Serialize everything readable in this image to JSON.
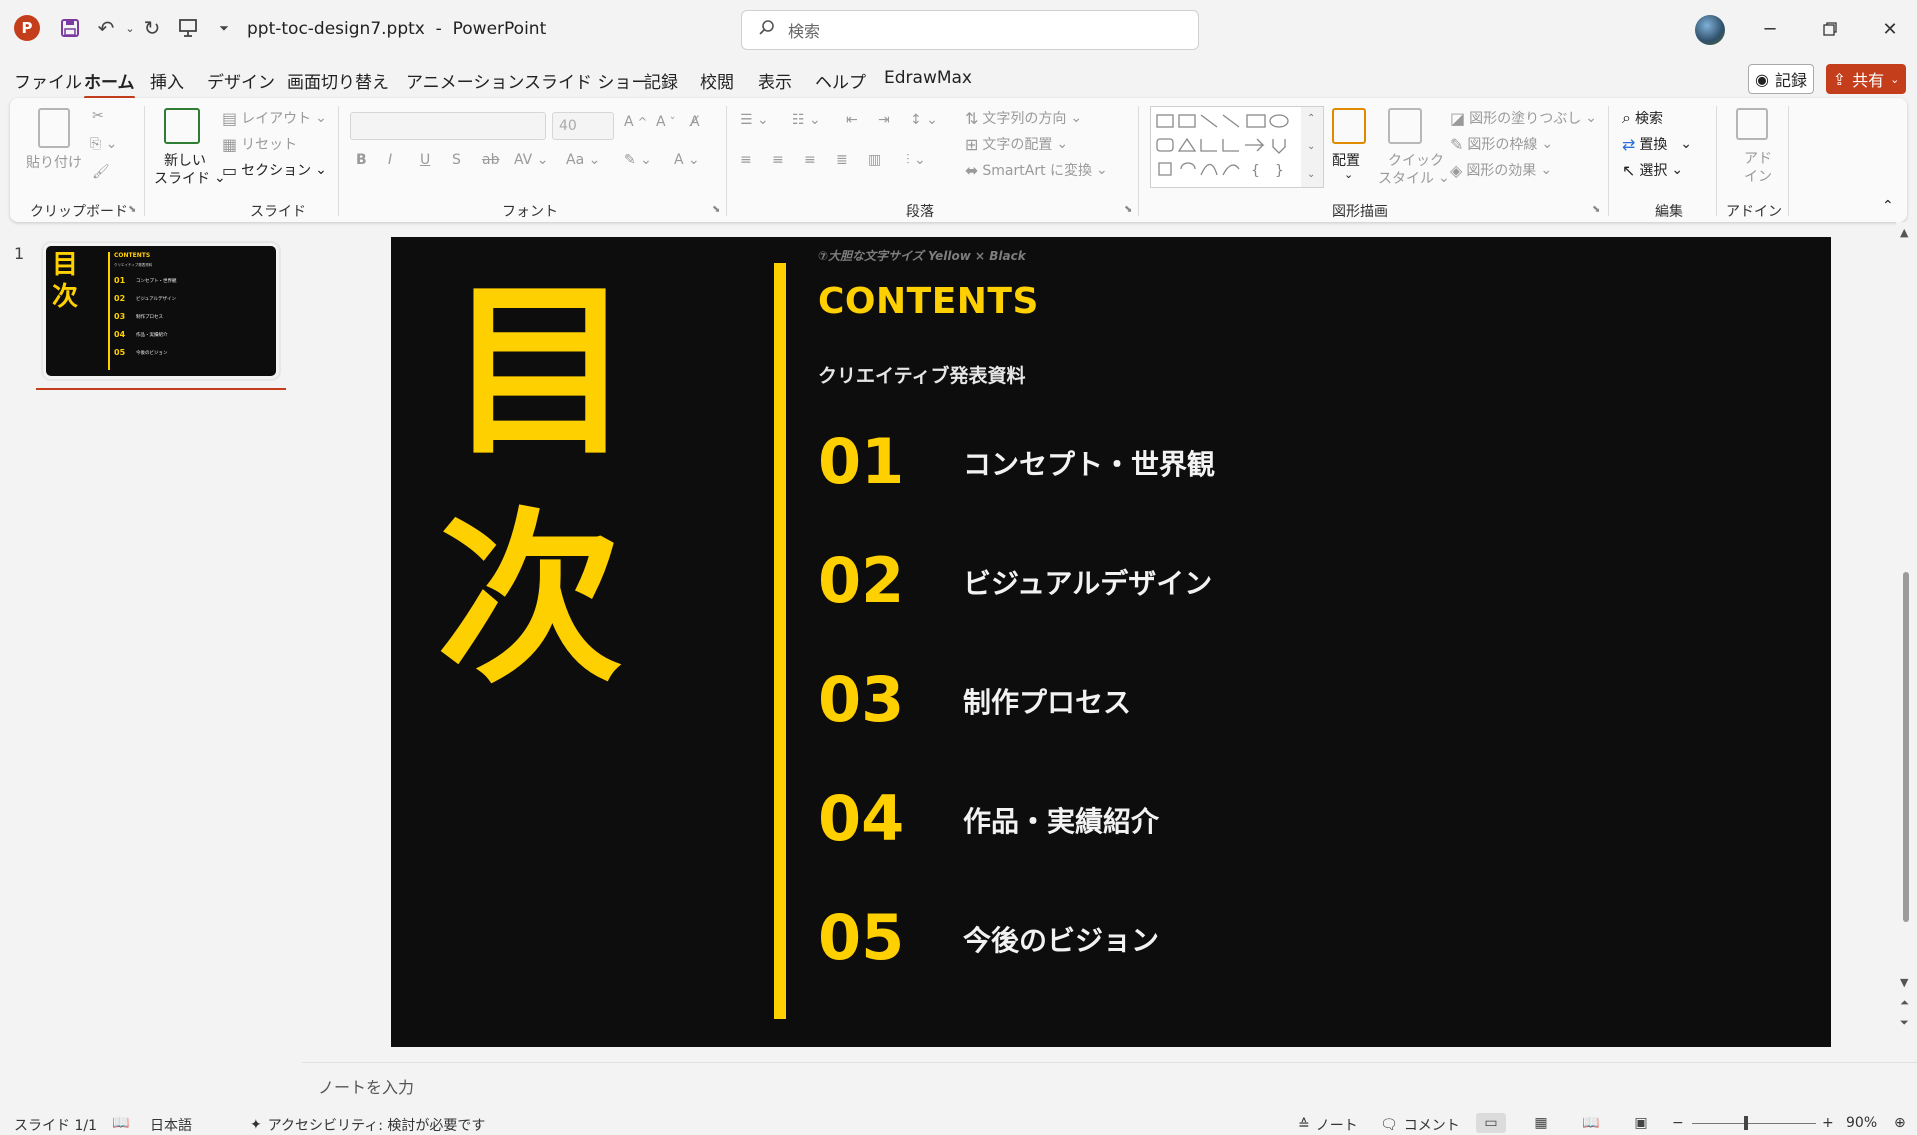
{
  "app": {
    "filename": "ppt-toc-design7.pptx",
    "separator": "-",
    "app_name": "PowerPoint",
    "search_placeholder": "検索"
  },
  "menu_tabs": [
    "ファイル",
    "ホーム",
    "挿入",
    "デザイン",
    "画面切り替え",
    "アニメーション",
    "スライド ショー",
    "記録",
    "校閲",
    "表示",
    "ヘルプ",
    "EdrawMax"
  ],
  "active_tab": "ホーム",
  "top_right": {
    "record": "記録",
    "share": "共有"
  },
  "ribbon": {
    "clipboard": {
      "label": "クリップボード",
      "paste": "貼り付け"
    },
    "slides": {
      "label": "スライド",
      "new_slide_1": "新しい",
      "new_slide_2": "スライド",
      "layout": "レイアウト",
      "reset": "リセット",
      "section": "セクション"
    },
    "font": {
      "label": "フォント",
      "size": "40"
    },
    "paragraph": {
      "label": "段落",
      "text_direction": "文字列の方向",
      "align_text": "文字の配置",
      "smartart": "SmartArt に変換"
    },
    "drawing": {
      "label": "図形描画",
      "arrange": "配置",
      "quick_styles_1": "クイック",
      "quick_styles_2": "スタイル",
      "shape_fill": "図形の塗りつぶし",
      "shape_outline": "図形の枠線",
      "shape_effects": "図形の効果"
    },
    "editing": {
      "label": "編集",
      "find": "検索",
      "replace": "置換",
      "select": "選択"
    },
    "addins": {
      "label": "アドイン",
      "addin_1": "アド",
      "addin_2": "イン"
    }
  },
  "thumbnail": {
    "number": "1"
  },
  "slide": {
    "caption": "⑦大胆な文字サイズ  Yellow × Black",
    "kanji_top": "目",
    "kanji_bottom": "次",
    "title": "CONTENTS",
    "subtitle": "クリエイティブ発表資料",
    "items": [
      {
        "num": "01",
        "label": "コンセプト・世界観"
      },
      {
        "num": "02",
        "label": "ビジュアルデザイン"
      },
      {
        "num": "03",
        "label": "制作プロセス"
      },
      {
        "num": "04",
        "label": "作品・実績紹介"
      },
      {
        "num": "05",
        "label": "今後のビジョン"
      }
    ]
  },
  "notes": {
    "placeholder": "ノートを入力"
  },
  "status": {
    "slide_count": "スライド 1/1",
    "language": "日本語",
    "accessibility": "アクセシビリティ: 検討が必要です",
    "notes": "ノート",
    "comments": "コメント",
    "zoom": "90%"
  },
  "colors": {
    "accent": "#c43e1c",
    "slide_bg": "#0d0d0d",
    "slide_yellow": "#ffd000"
  },
  "icons": [
    "powerpoint-logo-icon",
    "save-icon",
    "undo-icon",
    "redo-icon",
    "present-icon",
    "search-icon",
    "minimize-icon",
    "restore-icon",
    "close-icon"
  ]
}
